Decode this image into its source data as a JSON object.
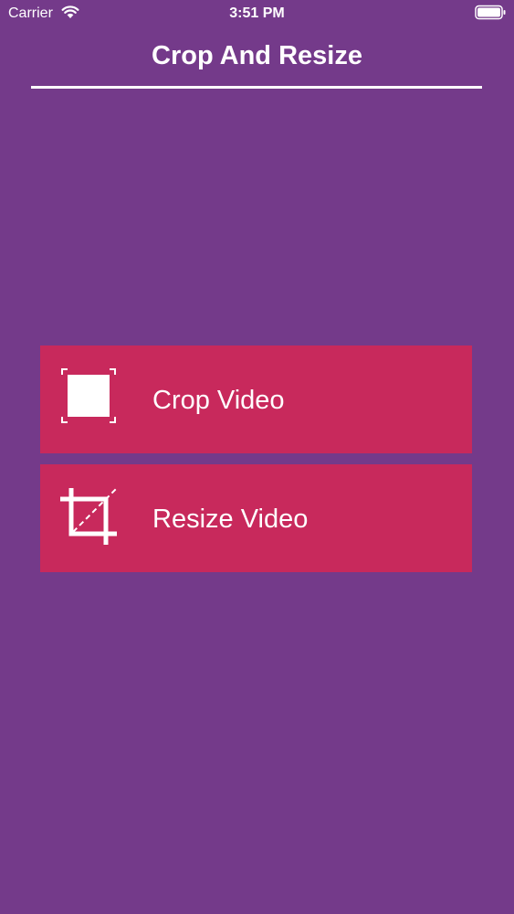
{
  "status_bar": {
    "carrier": "Carrier",
    "time": "3:51 PM",
    "wifi_icon": "wifi-icon",
    "battery_icon": "battery-icon"
  },
  "nav": {
    "title": "Crop And Resize"
  },
  "menu": {
    "items": [
      {
        "label": "Crop Video",
        "icon": "crop-frame-icon"
      },
      {
        "label": "Resize Video",
        "icon": "crop-resize-icon"
      }
    ]
  },
  "colors": {
    "background": "#743a8a",
    "button": "#c8295c",
    "text": "#ffffff"
  }
}
